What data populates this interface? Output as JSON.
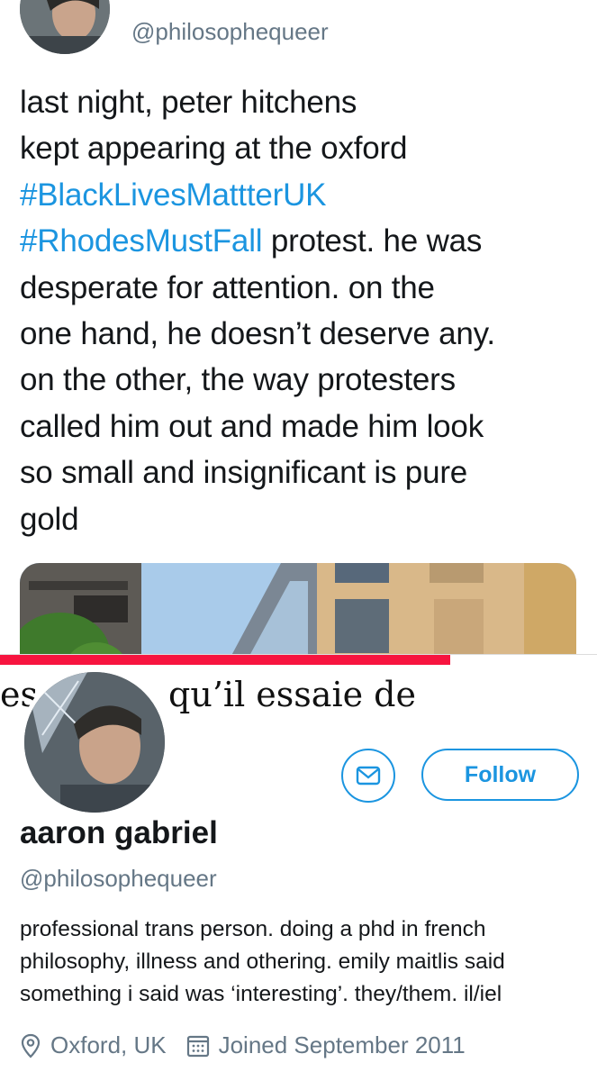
{
  "tweet": {
    "handle": "@philosophequeer",
    "text_lines": [
      {
        "text": "last night, peter hitchens"
      },
      {
        "text": "kept appearing at the oxford"
      },
      {
        "hashtag": "#BlackLivesMattterUK"
      },
      {
        "hashtag": "#RhodesMustFall",
        "text": " protest. he was"
      },
      {
        "text": "desperate for attention. on the"
      },
      {
        "text": "one hand, he doesn’t deserve any."
      },
      {
        "text": "on the other, the way protesters"
      },
      {
        "text": "called him out and made him look"
      },
      {
        "text": "so small and insignificant is pure"
      },
      {
        "text": "gold"
      }
    ]
  },
  "book_strip": {
    "text": "es   ards, qu’il essaie de"
  },
  "profile": {
    "follow_label": "Follow",
    "name": "aaron gabriel",
    "handle": "@philosophequeer",
    "bio_lines": [
      "professional trans person. doing a phd in french",
      "philosophy, illness and othering. emily maitlis said",
      "something i said was ‘interesting’. they/them. il/iel"
    ],
    "location": "Oxford, UK",
    "joined": "Joined September 2011"
  },
  "colors": {
    "accent": "#1b95e0",
    "secondary_text": "#657786",
    "red_rule": "#f7143f"
  }
}
